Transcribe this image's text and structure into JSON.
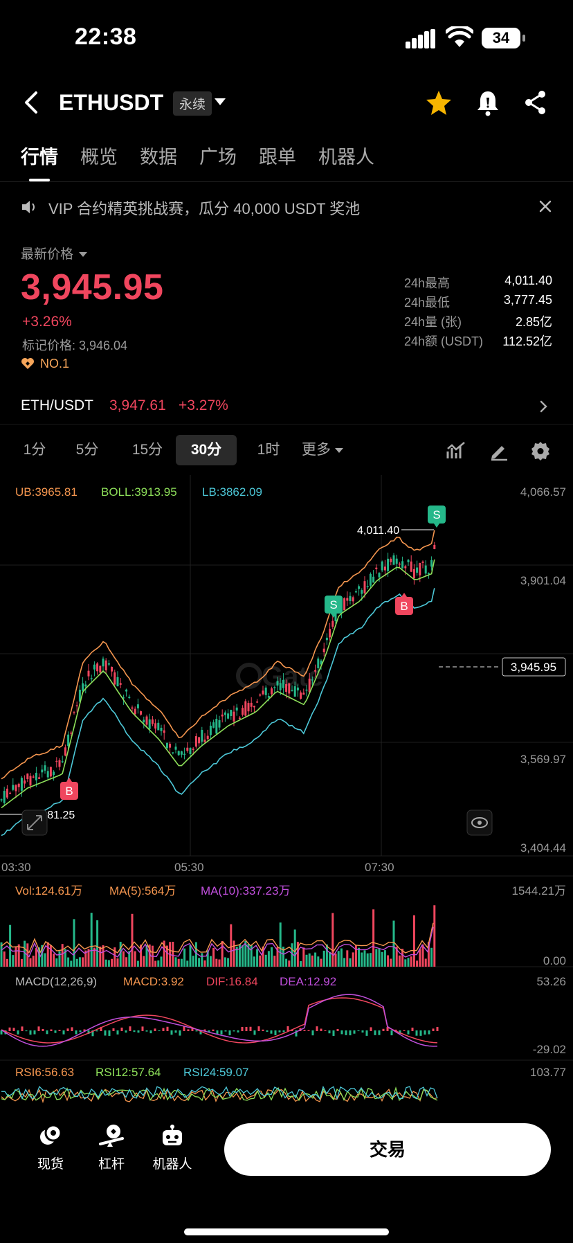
{
  "status": {
    "time": "22:38",
    "battery": "34"
  },
  "header": {
    "symbol": "ETHUSDT",
    "badge": "永续"
  },
  "tabs": [
    "行情",
    "概览",
    "数据",
    "广场",
    "跟单",
    "机器人"
  ],
  "announcement": "VIP 合约精英挑战赛，瓜分 40,000 USDT 奖池",
  "price": {
    "label": "最新价格",
    "last": "3,945.95",
    "change": "+3.26%",
    "mark": "标记价格: 3,946.04",
    "rank": "NO.1"
  },
  "stats": [
    {
      "label": "24h最高",
      "value": "4,011.40"
    },
    {
      "label": "24h最低",
      "value": "3,777.45"
    },
    {
      "label": "24h量 (张)",
      "value": "2.85亿"
    },
    {
      "label": "24h额 (USDT)",
      "value": "112.52亿"
    }
  ],
  "spot": {
    "pair": "ETH/USDT",
    "price": "3,947.61",
    "change": "+3.27%"
  },
  "intervals": [
    "1分",
    "5分",
    "15分",
    "30分",
    "1时",
    "更多"
  ],
  "indicators": {
    "boll": {
      "ub": "UB:3965.81",
      "boll": "BOLL:3913.95",
      "lb": "LB:3862.09"
    },
    "vol": {
      "vol": "Vol:124.61万",
      "ma5": "MA(5):564万",
      "ma10": "MA(10):337.23万"
    },
    "macd": {
      "name": "MACD(12,26,9)",
      "macd": "MACD:3.92",
      "dif": "DIF:16.84",
      "dea": "DEA:12.92"
    },
    "rsi": {
      "r6": "RSI6:56.63",
      "r12": "RSI12:57.64",
      "r24": "RSI24:59.07"
    }
  },
  "axis": {
    "price_ticks": [
      "4,066.57",
      "3,901.04",
      "3,569.97",
      "3,404.44"
    ],
    "time_ticks": [
      "03:30",
      "05:30",
      "07:30"
    ],
    "current_price": "3,945.95",
    "high_label": "4,011.40",
    "low_label": "3,481.25",
    "vol_ticks": [
      "1544.21万",
      "0.00"
    ],
    "macd_ticks": [
      "53.26",
      "-29.02"
    ],
    "rsi_ticks": [
      "103.77"
    ]
  },
  "markers": {
    "sell": "S",
    "buy": "B"
  },
  "bottom_nav": {
    "spot": "现货",
    "leverage": "杠杆",
    "bot": "机器人",
    "trade": "交易"
  },
  "colors": {
    "up": "#f0465e",
    "down": "#25b88a",
    "ub": "#f5964f",
    "boll": "#8ee05a",
    "lb": "#4dc8d8",
    "ma10": "#c04fdc"
  }
}
